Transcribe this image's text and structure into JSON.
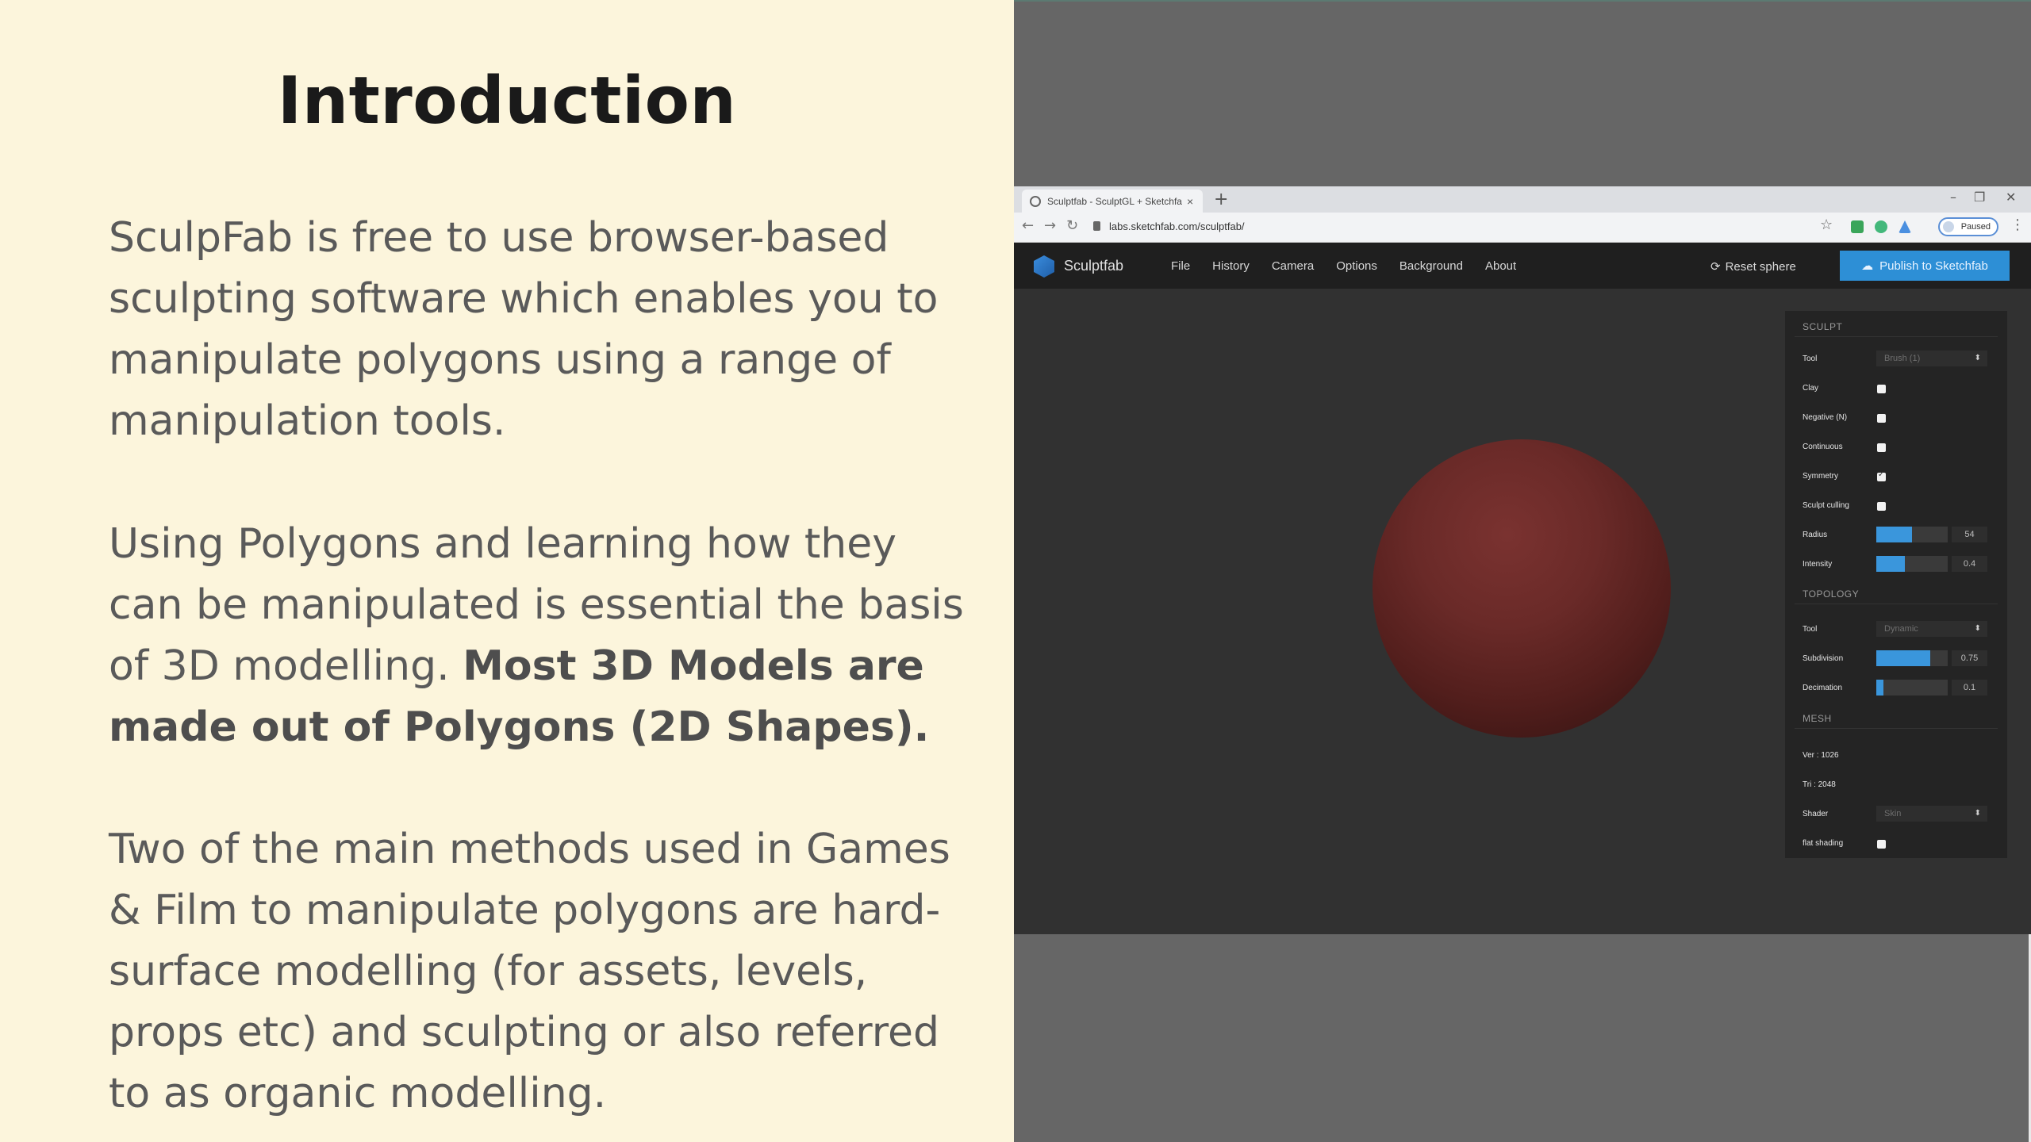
{
  "slide": {
    "title": "Introduction",
    "p1": "SculpFab is free to use browser-based sculpting software which enables you to manipulate polygons using a range of manipulation tools.",
    "p2_pre": "Using Polygons and learning how they can be manipulated is essential the basis of 3D modelling. ",
    "p2_bold": "Most 3D Models are made out of Polygons (2D Shapes).",
    "p3": "Two of the main methods used in Games & Film to manipulate polygons are hard-surface modelling (for assets, levels, props etc) and sculpting or also referred to as organic modelling."
  },
  "browser": {
    "tab_title": "Sculptfab - SculptGL + Sketchfab",
    "tab_close": "×",
    "new_tab": "+",
    "url": "labs.sketchfab.com/sculptfab/",
    "profile_status": "Paused",
    "window_controls": [
      "–",
      "❐",
      "✕"
    ],
    "nav_icons": [
      "←",
      "→",
      "↻"
    ],
    "star": "☆",
    "kebab": "⋮"
  },
  "app": {
    "brand": "Sculptfab",
    "menu": [
      "File",
      "History",
      "Camera",
      "Options",
      "Background",
      "About"
    ],
    "reset_label": "Reset sphere",
    "reset_icon": "⟳",
    "publish_label": "Publish to Sketchfab",
    "publish_icon": "☁",
    "accent_color": "#2d8fd6",
    "mesh_color": "#6a2a28"
  },
  "panel": {
    "sculpt_title": "SCULPT",
    "tool_label": "Tool",
    "tool_value": "Brush (1)",
    "clay_label": "Clay",
    "negative_label": "Negative (N)",
    "continuous_label": "Continuous",
    "symmetry_label": "Symmetry",
    "culling_label": "Sculpt culling",
    "radius_label": "Radius",
    "radius_value": "54",
    "radius_level": 0.5,
    "intensity_label": "Intensity",
    "intensity_value": "0.4",
    "intensity_level": 0.4,
    "topology_title": "TOPOLOGY",
    "topo_tool_label": "Tool",
    "topo_tool_value": "Dynamic",
    "subdivision_label": "Subdivision",
    "subdivision_value": "0.75",
    "subdivision_level": 0.75,
    "decimation_label": "Decimation",
    "decimation_value": "0.1",
    "decimation_level": 0.1,
    "mesh_title": "MESH",
    "ver": "Ver : 1026",
    "tri": "Tri : 2048",
    "shader_label": "Shader",
    "shader_value": "Skin",
    "flat_label": "flat shading",
    "select_arrow": "⬍"
  }
}
